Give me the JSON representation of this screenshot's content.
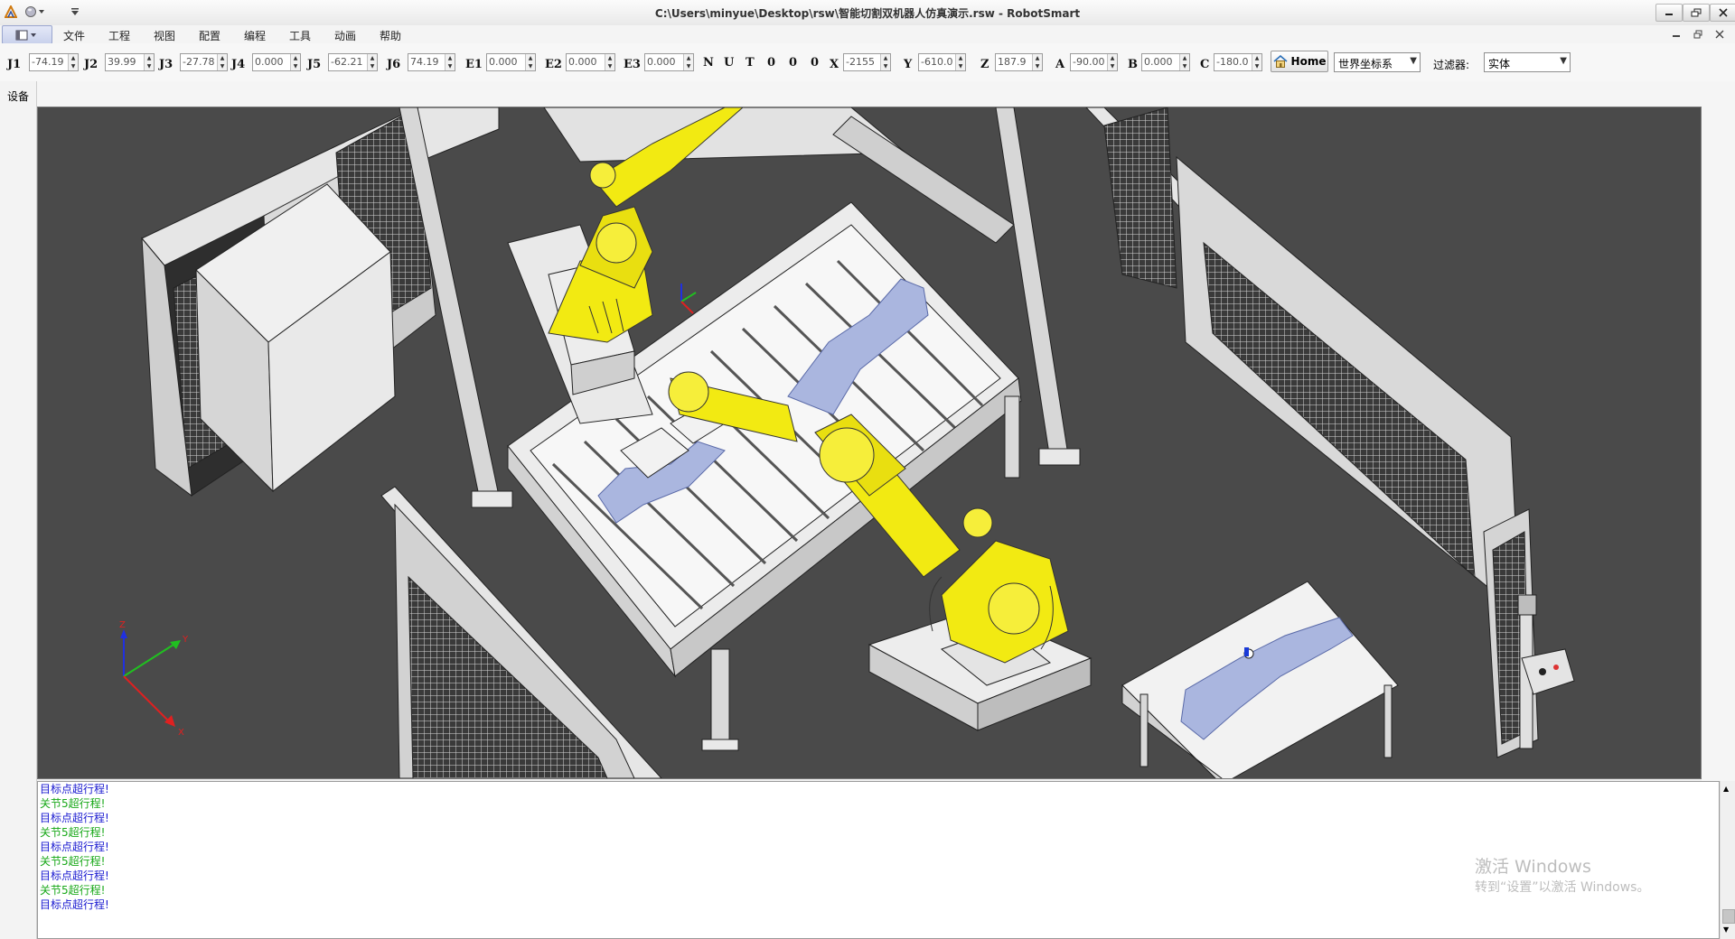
{
  "window": {
    "title": "C:\\Users\\minyue\\Desktop\\rsw\\智能切割双机器人仿真演示.rsw - RobotSmart"
  },
  "menu": [
    "文件",
    "工程",
    "视图",
    "配置",
    "编程",
    "工具",
    "动画",
    "帮助"
  ],
  "toolbar": {
    "joints": [
      {
        "label": "J1",
        "value": "-74.19"
      },
      {
        "label": "J2",
        "value": "39.99"
      },
      {
        "label": "J3",
        "value": "-27.78"
      },
      {
        "label": "J4",
        "value": "0.000"
      },
      {
        "label": "J5",
        "value": "-62.21"
      },
      {
        "label": "J6",
        "value": "74.19"
      },
      {
        "label": "E1",
        "value": "0.000"
      },
      {
        "label": "E2",
        "value": "0.000"
      },
      {
        "label": "E3",
        "value": "0.000"
      }
    ],
    "config_flags": [
      "N",
      "U",
      "T",
      "0",
      "0",
      "0"
    ],
    "coords": [
      {
        "label": "X",
        "value": "-2155"
      },
      {
        "label": "Y",
        "value": "-610.0"
      },
      {
        "label": "Z",
        "value": "187.9"
      },
      {
        "label": "A",
        "value": "-90.00"
      },
      {
        "label": "B",
        "value": "0.000"
      },
      {
        "label": "C",
        "value": "-180.0"
      }
    ],
    "home_label": "Home",
    "coord_system": "世界坐标系",
    "filter_label": "过滤器:",
    "filter_value": "实体"
  },
  "side": {
    "label": "设备"
  },
  "viewport": {
    "axis_labels": [
      "Z",
      "Y",
      "X"
    ],
    "colors": {
      "background": "#4a4a4a",
      "robot": "#f2ea12",
      "part": "#aab6df",
      "structure": "#e6e6e6"
    }
  },
  "log": [
    {
      "text": "目标点超行程!",
      "color": "#1a1ad0"
    },
    {
      "text": "关节5超行程!",
      "color": "#18a818"
    },
    {
      "text": "目标点超行程!",
      "color": "#1a1ad0"
    },
    {
      "text": "关节5超行程!",
      "color": "#18a818"
    },
    {
      "text": "目标点超行程!",
      "color": "#1a1ad0"
    },
    {
      "text": "关节5超行程!",
      "color": "#18a818"
    },
    {
      "text": "目标点超行程!",
      "color": "#1a1ad0"
    },
    {
      "text": "关节5超行程!",
      "color": "#18a818"
    },
    {
      "text": "目标点超行程!",
      "color": "#1a1ad0"
    }
  ],
  "watermark": {
    "title": "激活 Windows",
    "subtitle": "转到“设置”以激活 Windows。"
  }
}
